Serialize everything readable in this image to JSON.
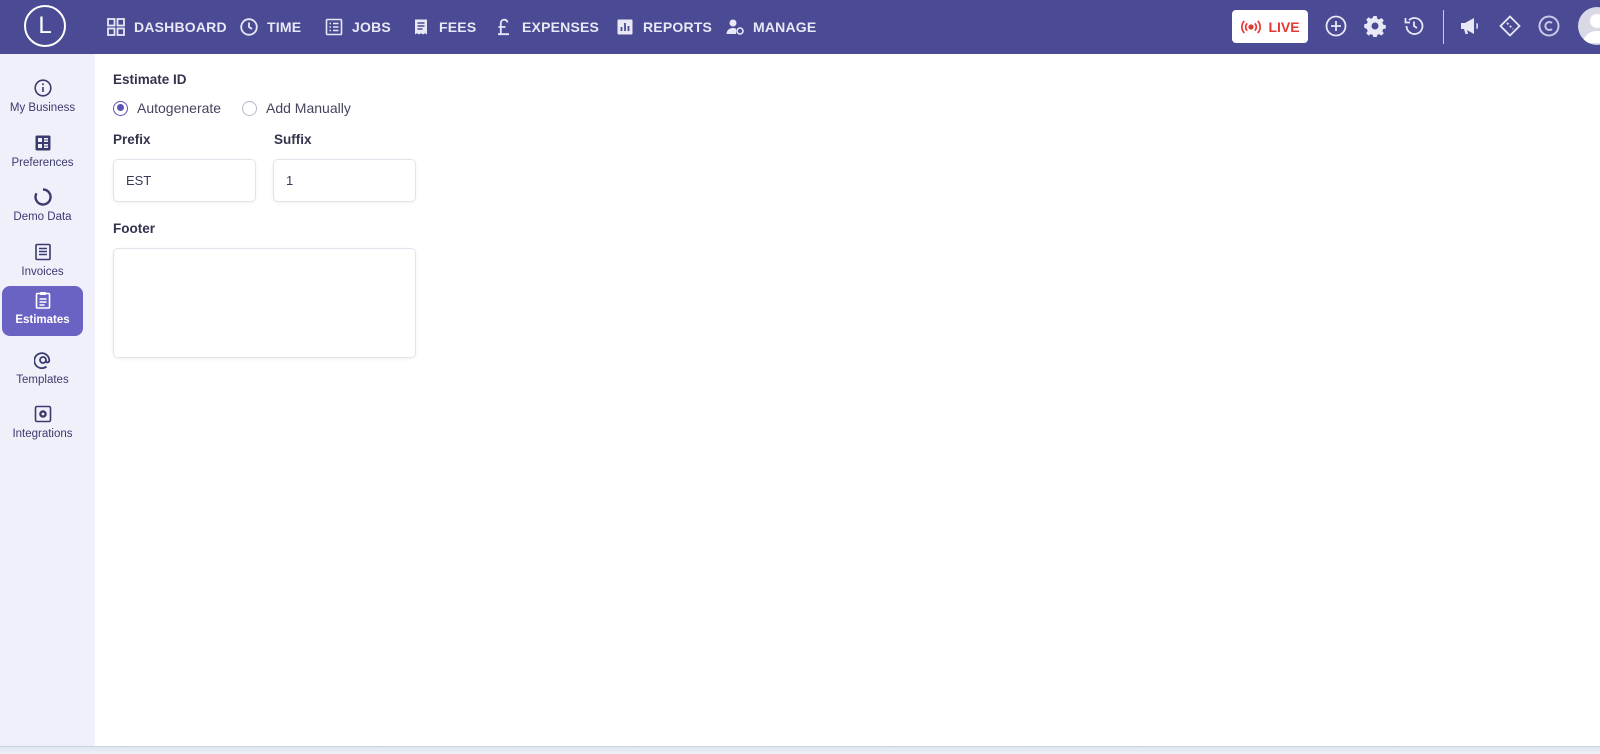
{
  "brand": {
    "logo_letter": "L"
  },
  "nav": [
    {
      "label": "DASHBOARD",
      "icon": "dashboard-grid-icon"
    },
    {
      "label": "TIME",
      "icon": "clock-icon"
    },
    {
      "label": "JOBS",
      "icon": "list-icon"
    },
    {
      "label": "FEES",
      "icon": "receipt-icon"
    },
    {
      "label": "EXPENSES",
      "icon": "pound-icon"
    },
    {
      "label": "REPORTS",
      "icon": "bar-chart-icon"
    },
    {
      "label": "MANAGE",
      "icon": "user-gear-icon"
    }
  ],
  "topbar_actions": {
    "live_label": "LIVE",
    "icons": [
      "add-circle-icon",
      "settings-gear-icon",
      "history-icon",
      "megaphone-icon",
      "ticket-icon",
      "currency-c-icon",
      "user-avatar-icon"
    ]
  },
  "sidebar": {
    "items": [
      {
        "label": "My Business",
        "icon": "info-icon"
      },
      {
        "label": "Preferences",
        "icon": "preferences-icon"
      },
      {
        "label": "Demo Data",
        "icon": "refresh-circle-icon"
      },
      {
        "label": "Invoices",
        "icon": "invoice-icon"
      },
      {
        "label": "Estimates",
        "icon": "clipboard-icon",
        "active": true
      },
      {
        "label": "Templates",
        "icon": "at-sign-icon"
      },
      {
        "label": "Integrations",
        "icon": "integration-gear-icon"
      }
    ]
  },
  "form": {
    "estimate_id_label": "Estimate ID",
    "radio_autogenerate": "Autogenerate",
    "radio_manual": "Add Manually",
    "selected": "Autogenerate",
    "prefix_label": "Prefix",
    "prefix_value": "EST",
    "suffix_label": "Suffix",
    "suffix_value": "1",
    "footer_label": "Footer",
    "footer_value": ""
  },
  "colors": {
    "topbar": "#4b4a94",
    "sidebar_bg": "#f0f0fb",
    "active_item": "#6a63c4",
    "live_red": "#e53935",
    "radio_accent": "#5a54b5"
  }
}
